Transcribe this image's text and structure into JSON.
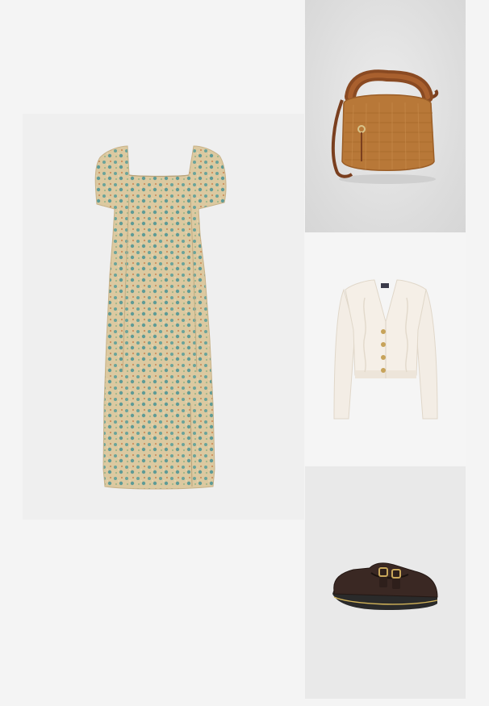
{
  "outfit": {
    "items": [
      {
        "name": "floral-midi-dress",
        "icon": "dress-icon",
        "color": "#d9c59b"
      },
      {
        "name": "straw-handbag",
        "icon": "handbag-icon",
        "color": "#b77433"
      },
      {
        "name": "cable-knit-cardigan",
        "icon": "cardigan-icon",
        "color": "#f2ece4"
      },
      {
        "name": "leather-mary-jane-shoes",
        "icon": "shoe-icon",
        "color": "#3b2a22"
      }
    ]
  },
  "colors": {
    "page_background": "#f4f4f4",
    "dress_tile": "#efefef",
    "bag_tile": "#dcdcdc",
    "cardigan_tile": "#f5f5f5",
    "shoe_tile": "#e9e9e9"
  }
}
